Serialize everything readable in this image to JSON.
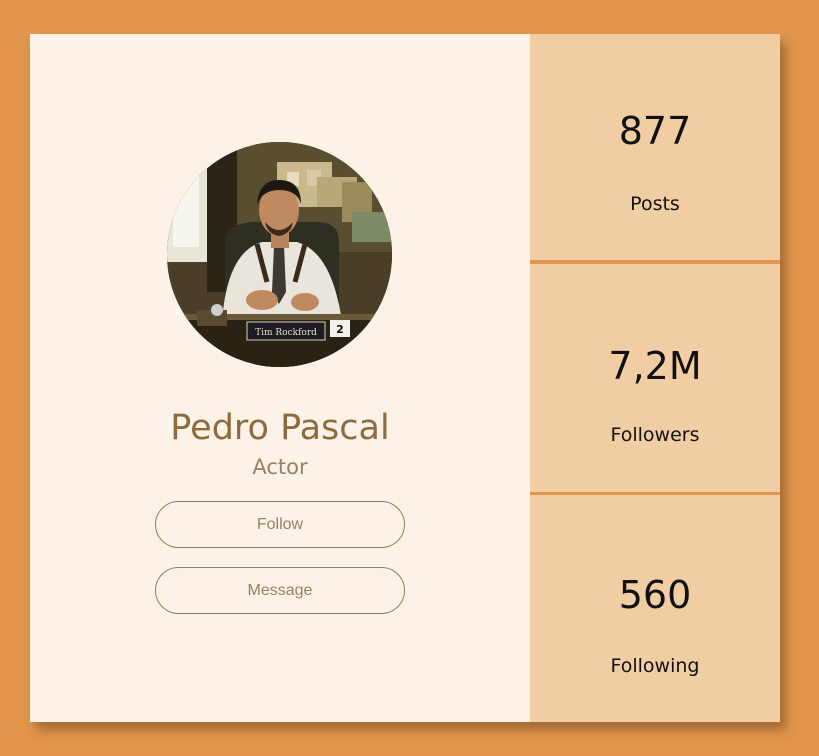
{
  "profile": {
    "name": "Pedro Pascal",
    "role": "Actor",
    "nameplate": "Tim Rockford",
    "desk_number": "2",
    "follow_label": "Follow",
    "message_label": "Message"
  },
  "stats": {
    "posts": {
      "value": "877",
      "label": "Posts"
    },
    "followers": {
      "value": "7,2M",
      "label": "Followers"
    },
    "following": {
      "value": "560",
      "label": "Following"
    }
  },
  "colors": {
    "page_background": "#e2964c",
    "profile_panel": "#fdf2e7",
    "stat_panel": "#f1cda3",
    "name_text": "#8c6b3f",
    "button_border": "#9c7a52"
  }
}
